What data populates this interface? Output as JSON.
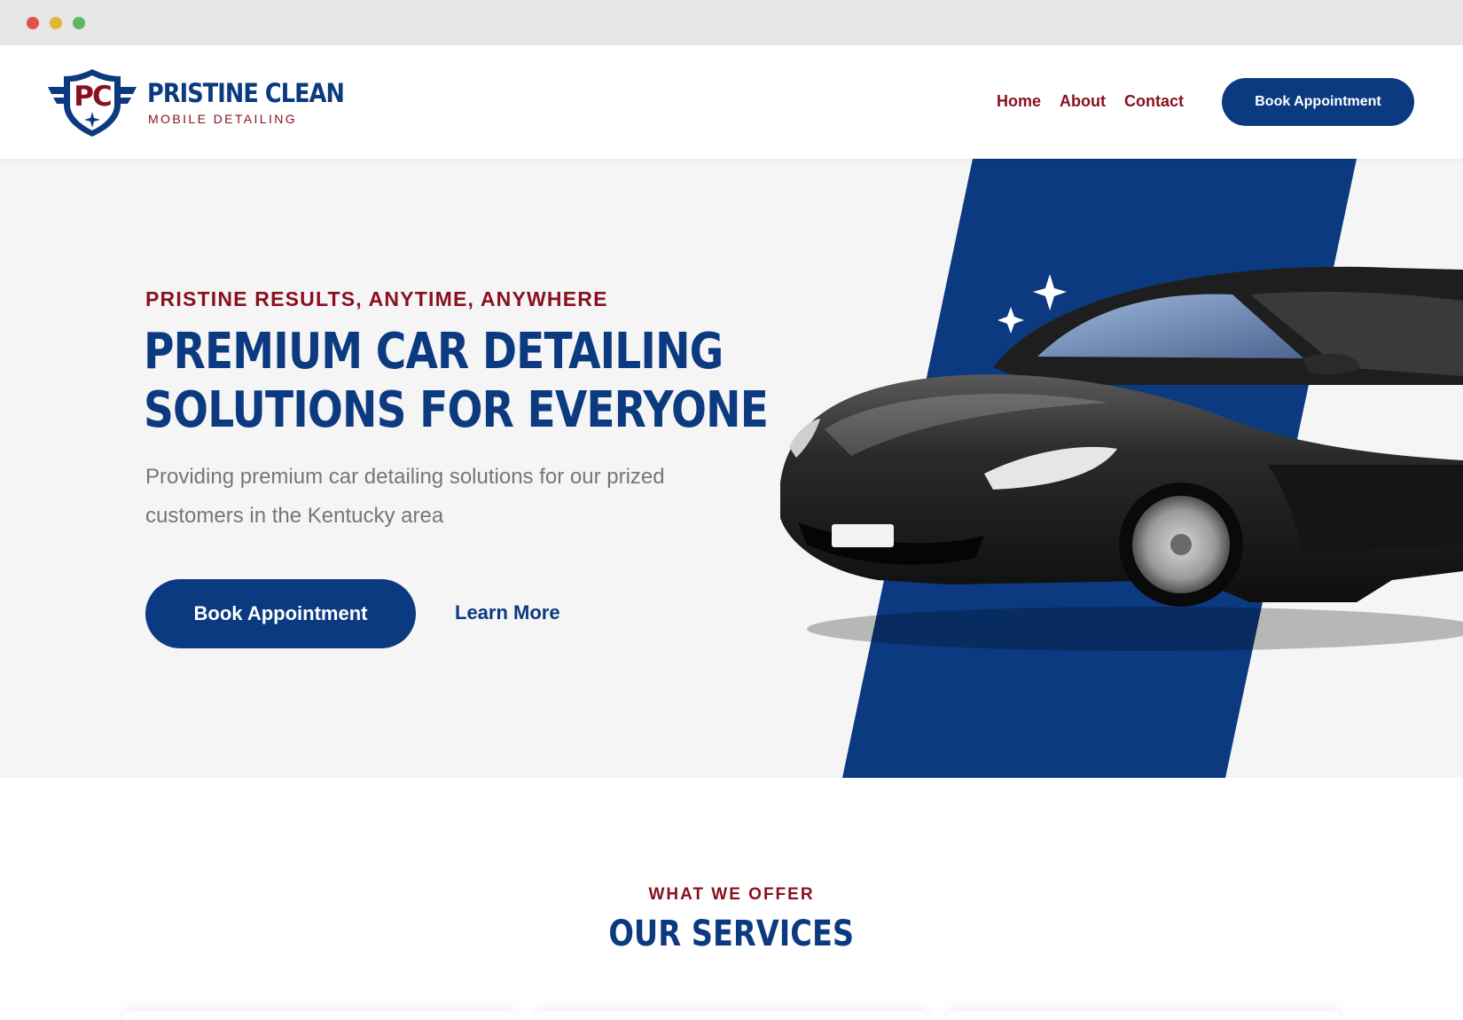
{
  "brand": {
    "initials": "PC",
    "name": "PRISTINE CLEAN",
    "subtitle": "MOBILE DETAILING"
  },
  "nav": {
    "items": [
      "Home",
      "About",
      "Contact"
    ],
    "cta_label": "Book Appointment"
  },
  "hero": {
    "tagline": "PRISTINE RESULTS, ANYTIME, ANYWHERE",
    "title_line1": "PREMIUM CAR DETAILING",
    "title_line2": "SOLUTIONS FOR EVERYONE",
    "description": "Providing premium car detailing solutions for our prized customers in the Kentucky area",
    "primary_cta": "Book Appointment",
    "secondary_cta": "Learn More"
  },
  "services": {
    "eyebrow": "WHAT WE OFFER",
    "title": "OUR SERVICES"
  },
  "colors": {
    "brand_blue": "#0b3a80",
    "brand_red": "#8a1020",
    "hero_bg": "#f5f5f5",
    "text_gray": "#767676"
  }
}
